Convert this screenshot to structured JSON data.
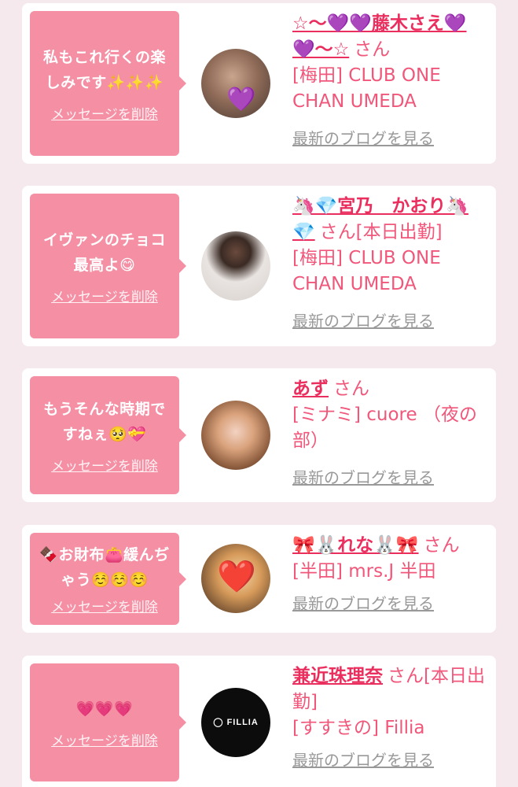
{
  "colors": {
    "page_background": "#f6e9ed",
    "bubble": "#f48fa4",
    "name": "#ea2f5f",
    "text": "#f0577a",
    "link": "#999999"
  },
  "delete_label": "メッセージを削除",
  "blog_label": "最新のブログを見る",
  "cards": [
    {
      "message": "私もこれ行くの楽しみです✨✨✨",
      "name": "☆〜💜💜藤木さえ💜💜〜☆",
      "suffix": "さん",
      "store": "[梅田] CLUB ONE CHAN UMEDA",
      "avatar_icon": "purple-heart-icon"
    },
    {
      "message": "イヴァンのチョコ最高よ😋",
      "name": "🦄💎宮乃　かおり🦄💎",
      "suffix": "さん[本日出勤]",
      "store": "[梅田] CLUB ONE CHAN UMEDA",
      "avatar_icon": "person-photo"
    },
    {
      "message": "もうそんな時期ですねぇ🥺💝",
      "name": "あず",
      "suffix": "さん",
      "store": "[ミナミ] cuore （夜の部）",
      "avatar_icon": "person-photo"
    },
    {
      "message": "🍫お財布👛緩んぢゃう☺️☺️☺️",
      "name": "🎀🐰れな🐰🎀",
      "suffix": "さん",
      "store": "[半田] mrs.J 半田",
      "avatar_icon": "red-heart-icon"
    },
    {
      "message": "💗💗💗",
      "name": "兼近珠理奈",
      "suffix": "さん[本日出勤]",
      "store": "[すすきの] Fillia",
      "avatar_icon": "fillia-logo",
      "avatar_text": "◯ FILLIA"
    }
  ]
}
